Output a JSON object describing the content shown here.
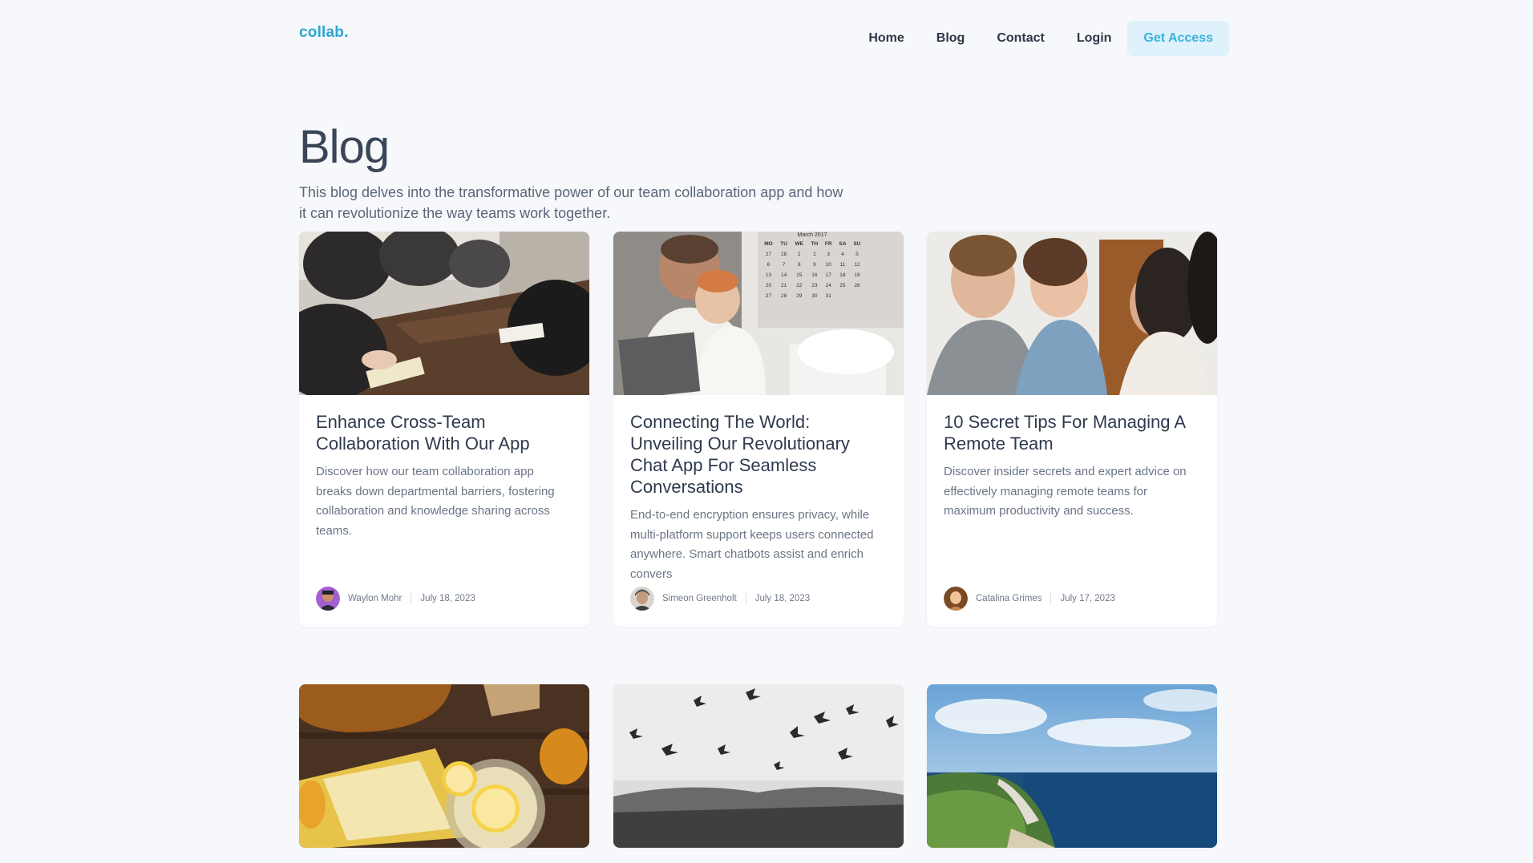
{
  "brand": {
    "logo": "collab."
  },
  "nav": {
    "home": "Home",
    "blog": "Blog",
    "contact": "Contact",
    "login": "Login",
    "cta": "Get Access"
  },
  "hero": {
    "title": "Blog",
    "description": "This blog delves into the transformative power of our team collaboration app and how it can revolutionize the way teams work together."
  },
  "posts": [
    {
      "title": "Enhance Cross-Team Collaboration With Our App",
      "excerpt": "Discover how our team collaboration app breaks down departmental barriers, fostering collaboration and knowledge sharing across teams.",
      "author": "Waylon Mohr",
      "date": "July 18, 2023",
      "image": "team-meeting-table-photo"
    },
    {
      "title": "Connecting The World: Unveiling Our Revolutionary Chat App For Seamless Conversations",
      "excerpt": "End-to-end encryption ensures privacy, while multi-platform support keeps users connected anywhere. Smart chatbots assist and enrich convers",
      "author": "Simeon Greenholt",
      "date": "July 18, 2023",
      "image": "father-child-laptop-calendar-photo",
      "calendar": {
        "month": "March 2017",
        "days": [
          "MO",
          "TU",
          "WE",
          "TH",
          "FR",
          "SA",
          "SU"
        ],
        "rows": [
          [
            "27",
            "28",
            "1",
            "2",
            "3",
            "4",
            "5"
          ],
          [
            "6",
            "7",
            "8",
            "9",
            "10",
            "11",
            "12"
          ],
          [
            "13",
            "14",
            "15",
            "16",
            "17",
            "18",
            "19"
          ],
          [
            "20",
            "21",
            "22",
            "23",
            "24",
            "25",
            "26"
          ],
          [
            "27",
            "28",
            "29",
            "30",
            "31",
            "",
            ""
          ]
        ]
      }
    },
    {
      "title": "10 Secret Tips For Managing A Remote Team",
      "excerpt": "Discover insider secrets and expert advice on effectively managing remote teams for maximum productivity and success.",
      "author": "Catalina Grimes",
      "date": "July 17, 2023",
      "image": "friends-laughing-photo"
    },
    {
      "title": "",
      "excerpt": "",
      "author": "",
      "date": "",
      "image": "lemon-drink-photo"
    },
    {
      "title": "",
      "excerpt": "",
      "author": "",
      "date": "",
      "image": "birds-field-bw-photo"
    },
    {
      "title": "",
      "excerpt": "",
      "author": "",
      "date": "",
      "image": "coastline-cliffs-photo"
    }
  ],
  "colors": {
    "accent": "#2aa7d3",
    "cta_bg": "#dff1fb",
    "page_bg": "#f7f8fb",
    "card_bg": "#ffffff"
  }
}
